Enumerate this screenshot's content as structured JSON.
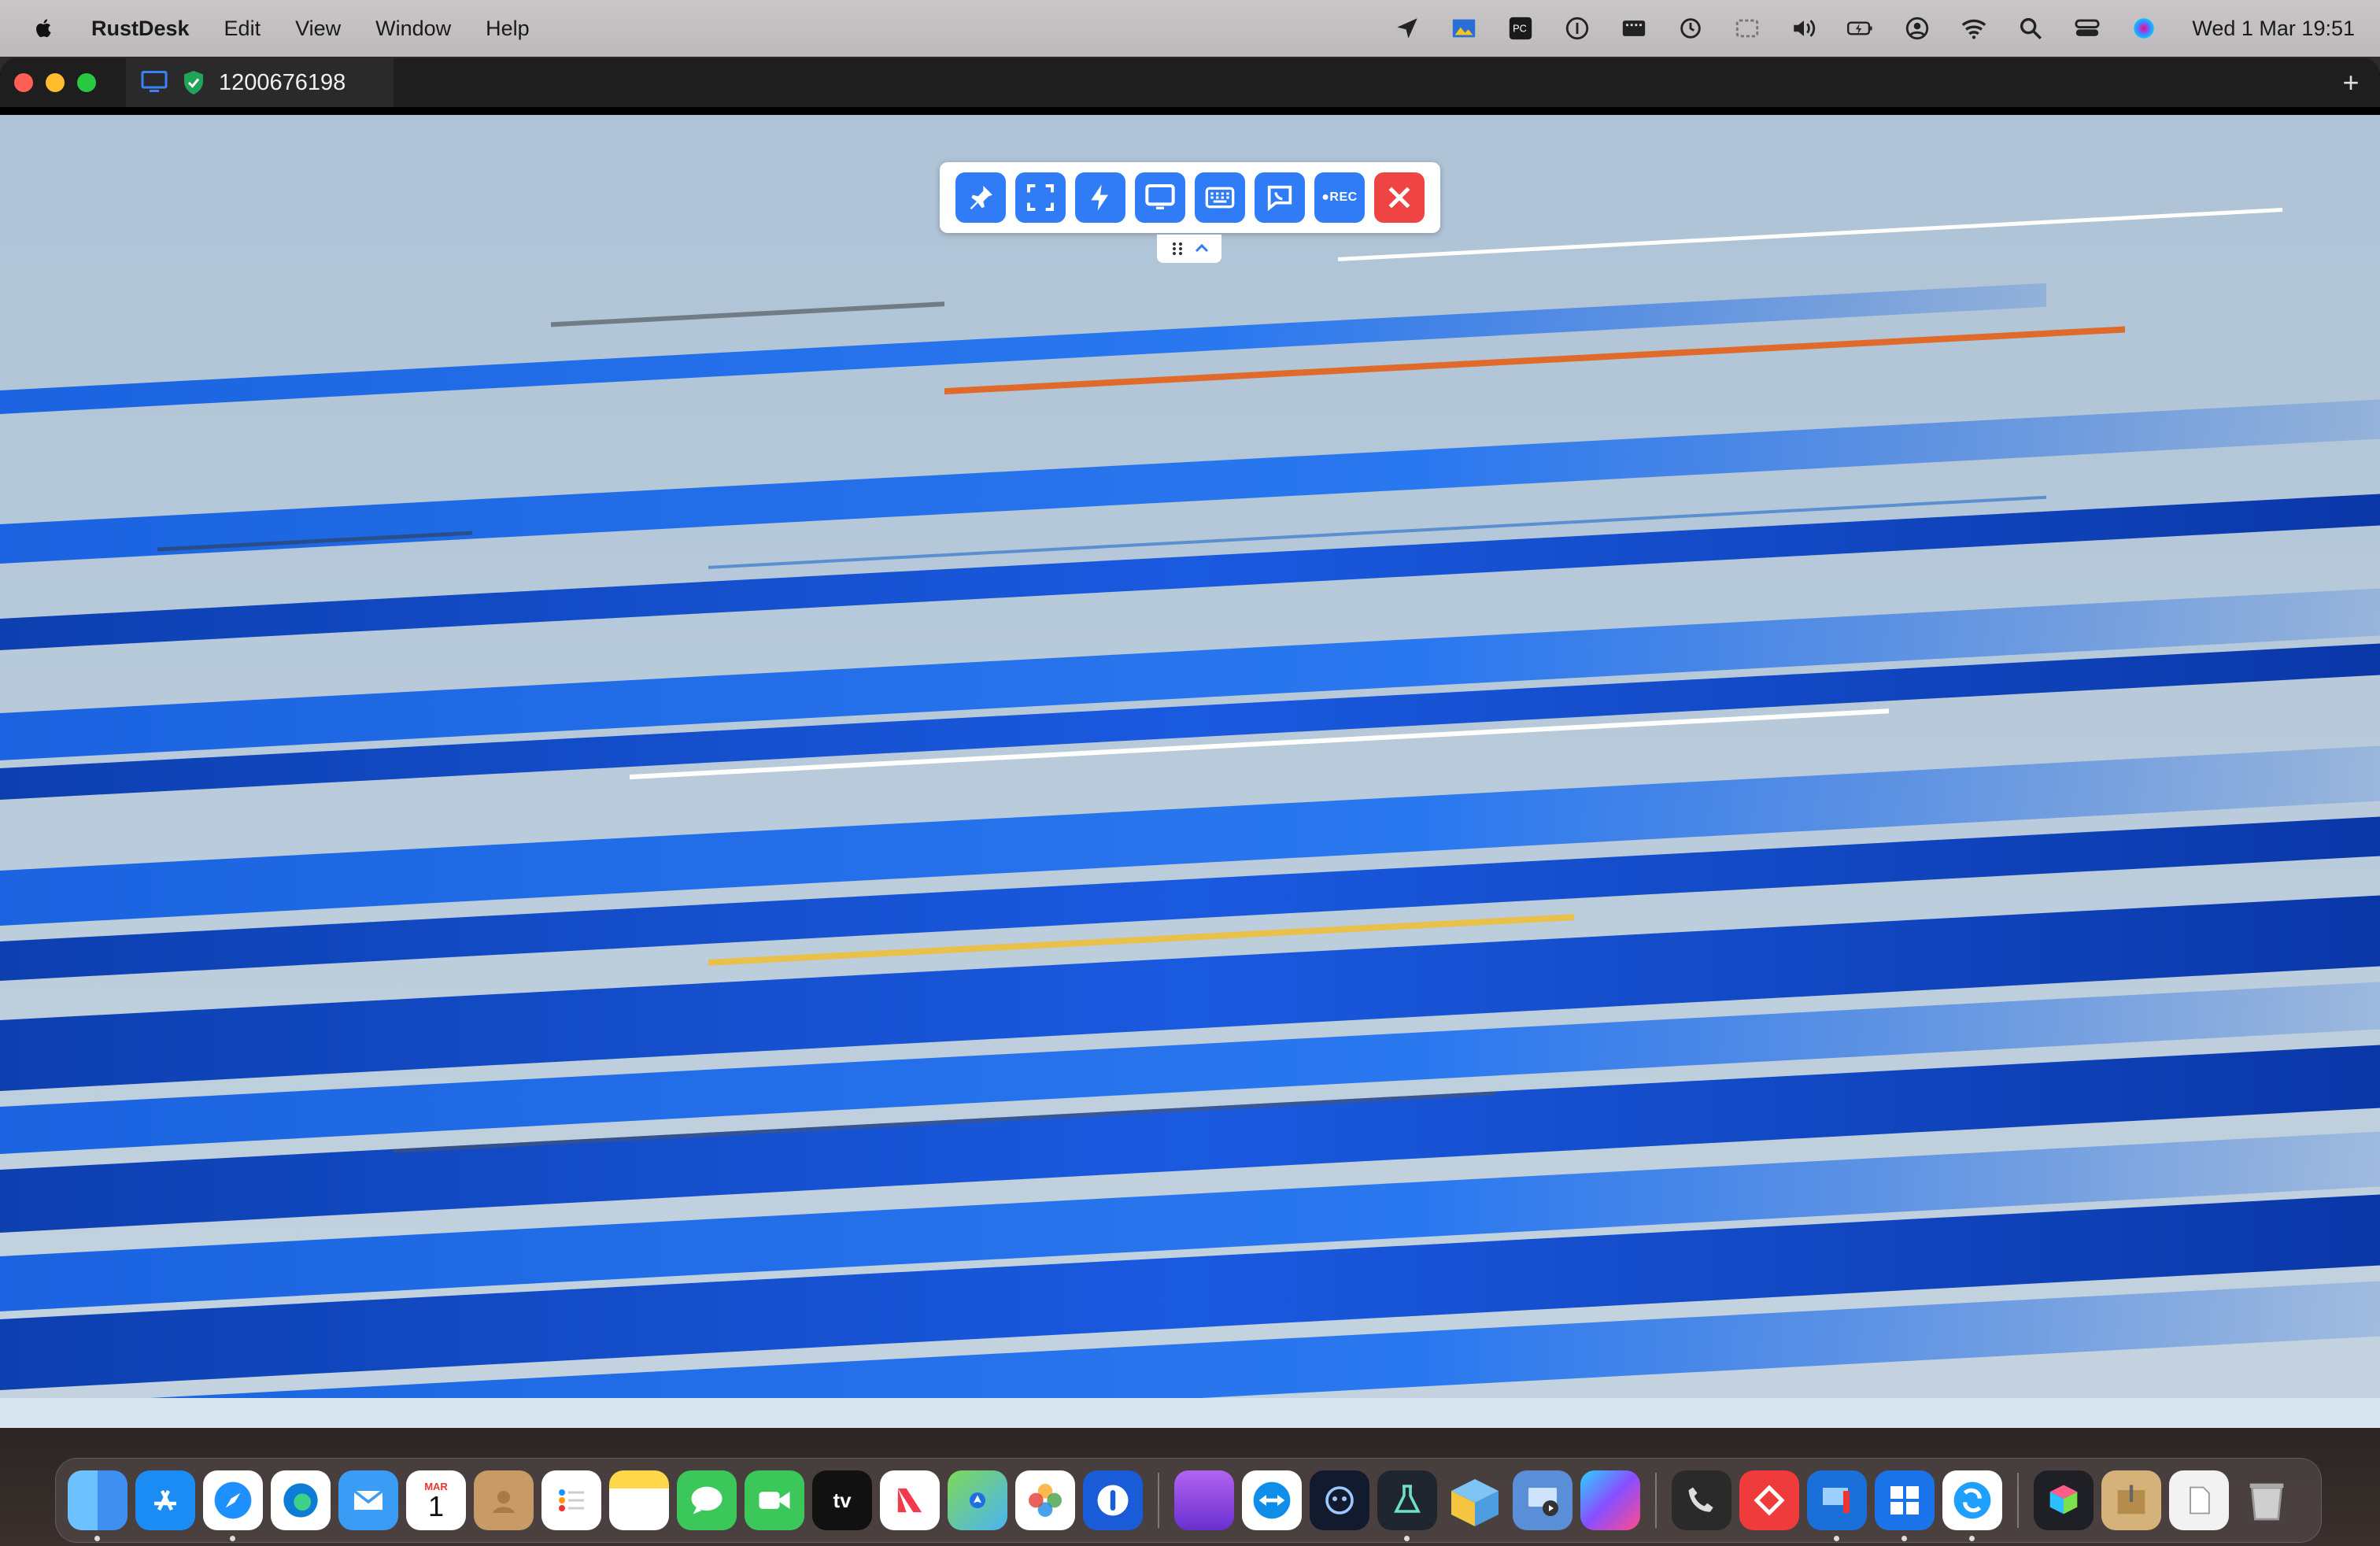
{
  "menubar": {
    "app_name": "RustDesk",
    "menus": [
      "Edit",
      "View",
      "Window",
      "Help"
    ],
    "clock": "Wed 1 Mar  19:51",
    "status_icons": [
      "location-icon",
      "image-capture-icon",
      "pycharm-icon",
      "onepassword-icon",
      "keyboard-viewer-icon",
      "time-machine-icon",
      "screen-mirror-icon",
      "volume-icon",
      "battery-icon",
      "user-icon",
      "wifi-icon",
      "spotlight-icon",
      "control-center-icon",
      "siri-icon"
    ]
  },
  "window": {
    "tab_title": "1200676198",
    "new_tab_label": "+"
  },
  "toolbar": {
    "buttons": [
      "pin-icon",
      "fullscreen-icon",
      "action-icon",
      "display-icon",
      "keyboard-icon",
      "chat-icon",
      "record-icon",
      "close-icon"
    ],
    "record_label": "●REC"
  },
  "dock": {
    "apps": [
      "Finder",
      "App Store",
      "Safari",
      "Edge",
      "Mail",
      "Calendar",
      "Contacts",
      "Reminders",
      "Notes",
      "Messages",
      "FaceTime",
      "TV",
      "News",
      "Maps",
      "Photos",
      "1Password",
      "Window Manager",
      "TeamViewer",
      "Bot",
      "Flask",
      "Mail Archive",
      "Screen Share",
      "Screens",
      "Phone",
      "AnyDesk",
      "Remote Desktop",
      "Windows App",
      "RustDesk",
      "Box App",
      "Archive Utility",
      "Downloads",
      "Trash"
    ],
    "calendar_month": "MAR",
    "calendar_day": "1",
    "tv_label": "tv"
  },
  "colors": {
    "toolbar_blue": "#2f7cf6",
    "toolbar_red": "#ef4444",
    "wallpaper_light": "#b4c8d8",
    "wallpaper_blue": "#1c5fd8"
  }
}
